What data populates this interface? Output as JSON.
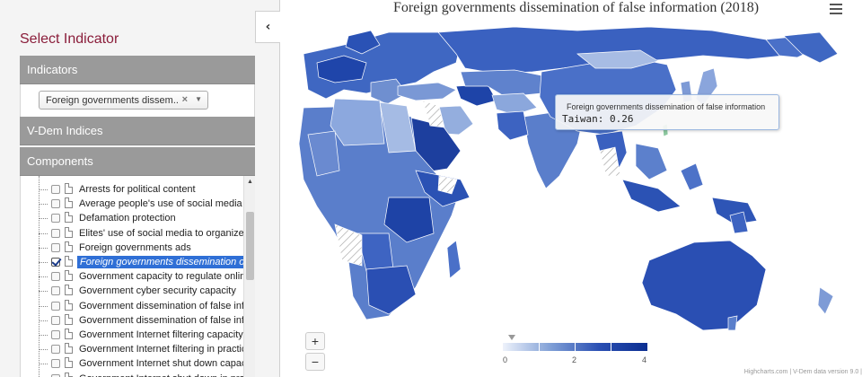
{
  "panel": {
    "title": "Select Indicator",
    "collapse_icon": "‹",
    "sections": {
      "indicators": "Indicators",
      "vdem": "V-Dem Indices",
      "components": "Components"
    },
    "indicator_select": {
      "value": "Foreign governments dissem...",
      "clear": "×",
      "arrow": "▼"
    },
    "tree_items": [
      {
        "label": "Arrests for political content",
        "checked": false
      },
      {
        "label": "Average people's use of social media to organize offline action",
        "checked": false
      },
      {
        "label": "Defamation protection",
        "checked": false
      },
      {
        "label": "Elites' use of social media to organize offline action",
        "checked": false
      },
      {
        "label": "Foreign governments ads",
        "checked": false
      },
      {
        "label": "Foreign governments dissemination of false information",
        "checked": true
      },
      {
        "label": "Government capacity to regulate online content",
        "checked": false
      },
      {
        "label": "Government cyber security capacity",
        "checked": false
      },
      {
        "label": "Government dissemination of false information domestic",
        "checked": false
      },
      {
        "label": "Government dissemination of false information abroad",
        "checked": false
      },
      {
        "label": "Government Internet filtering capacity",
        "checked": false
      },
      {
        "label": "Government Internet filtering in practice",
        "checked": false
      },
      {
        "label": "Government Internet shut down capacity",
        "checked": false
      },
      {
        "label": "Government Internet shut down in practice",
        "checked": false
      }
    ],
    "scroll_up_icon": "▲"
  },
  "map": {
    "title": "Foreign governments dissemination of false information (2018)",
    "tooltip": {
      "title": "Foreign governments dissemination of false information",
      "value": "Taiwan: 0.26"
    },
    "zoom_in": "+",
    "zoom_out": "−",
    "legend": {
      "min": "0",
      "mid": "2",
      "max": "4",
      "colors": [
        "#eef2fb",
        "#0b2e91"
      ]
    },
    "credits": "Highcharts.com | V-Dem data version 9.0 |"
  }
}
